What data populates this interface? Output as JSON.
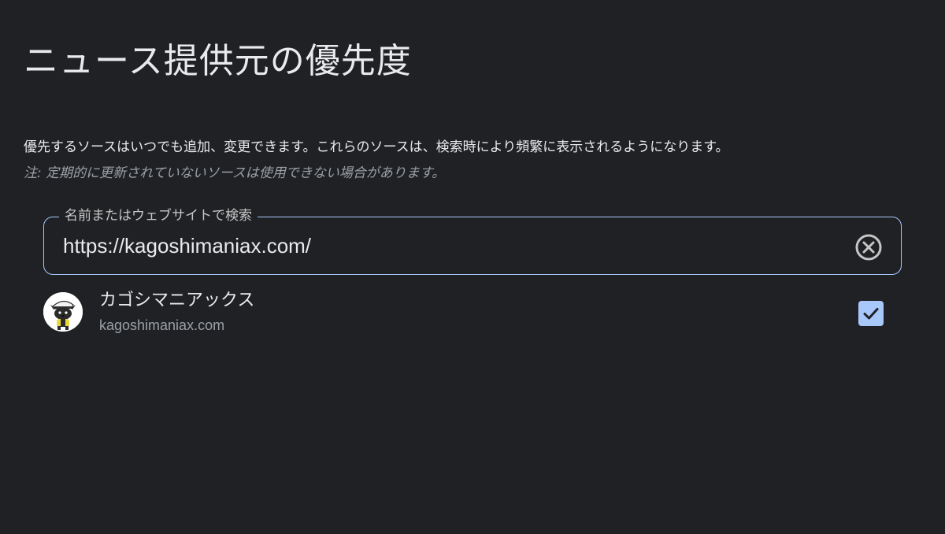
{
  "page": {
    "title": "ニュース提供元の優先度",
    "description": "優先するソースはいつでも追加、変更できます。これらのソースは、検索時により頻繁に表示されるようになります。",
    "note": "注: 定期的に更新されていないソースは使用できない場合があります。"
  },
  "search": {
    "label": "名前またはウェブサイトで検索",
    "value": "https://kagoshimaniax.com/",
    "clear_icon": "close-circle-icon"
  },
  "results": [
    {
      "name": "カゴシマニアックス",
      "domain": "kagoshimaniax.com",
      "checked": true,
      "avatar_icon": "dog-mascot-logo"
    }
  ],
  "colors": {
    "background": "#202124",
    "text": "#e8eaed",
    "secondary_text": "#9aa0a6",
    "accent": "#a8c7fa",
    "checkmark": "#202124"
  }
}
